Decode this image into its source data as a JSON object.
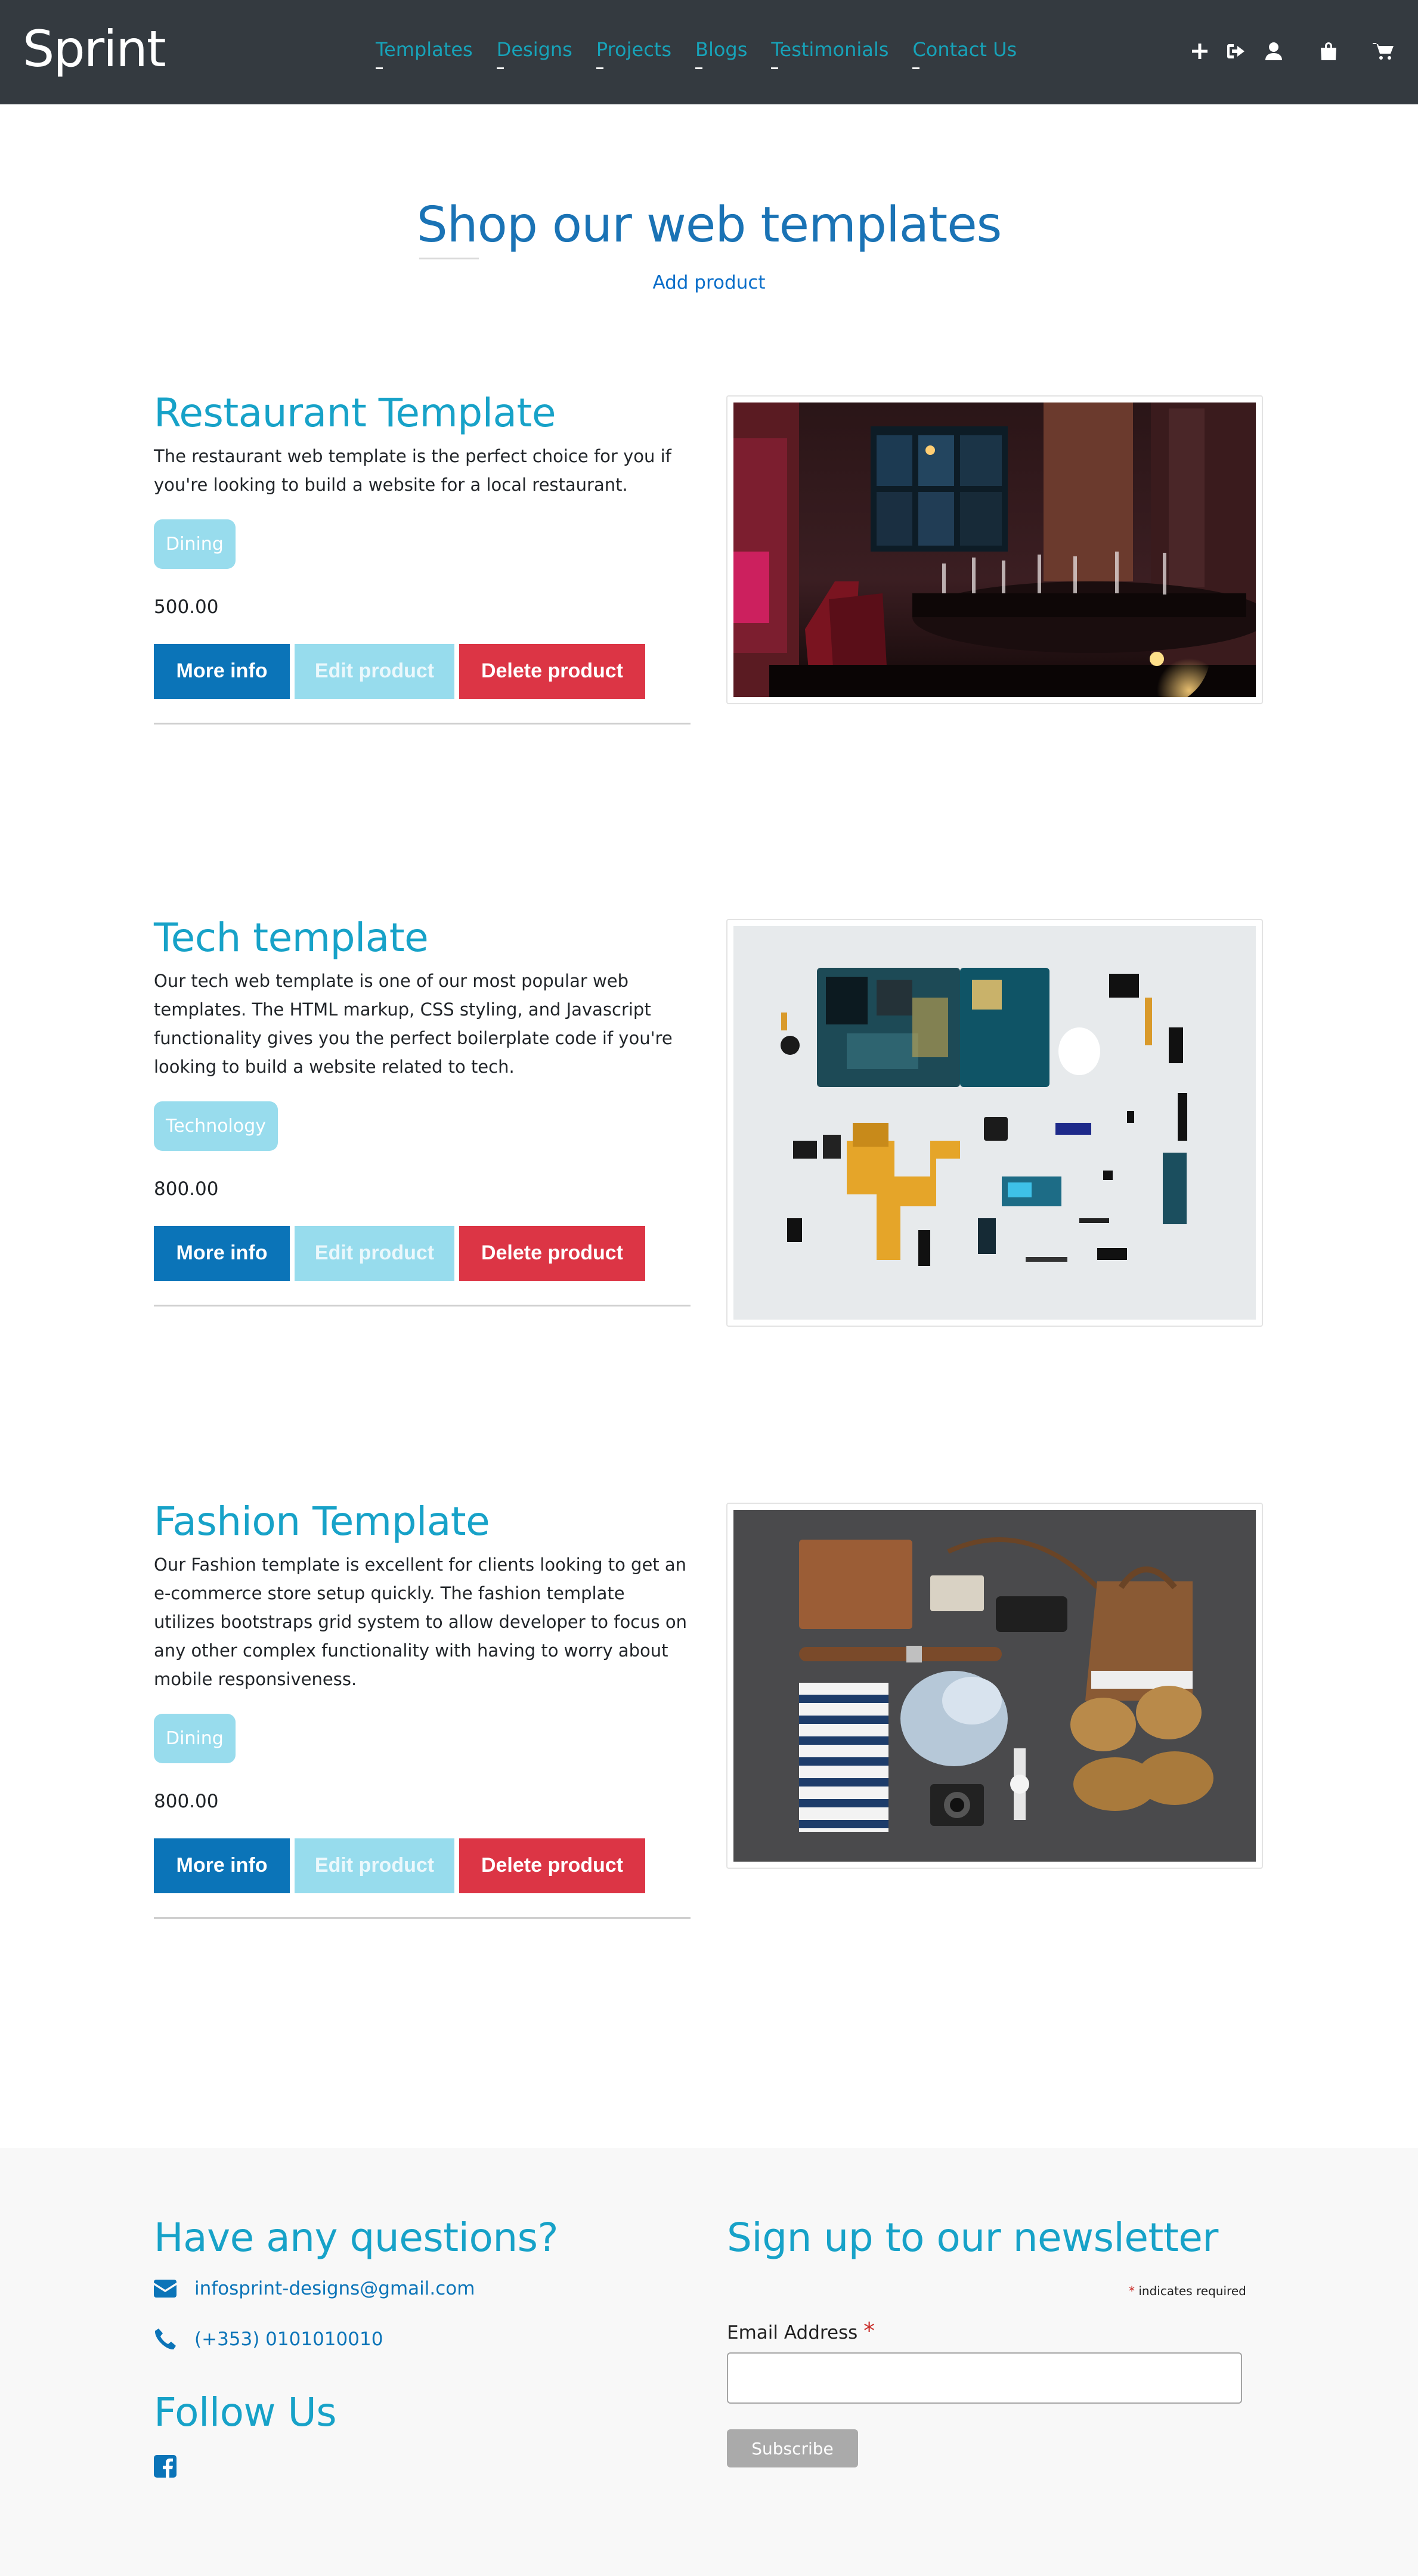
{
  "navbar": {
    "brand": "Sprint",
    "links": [
      "Templates",
      "Designs",
      "Projects",
      "Blogs",
      "Testimonials",
      "Contact Us"
    ],
    "icons": [
      "plus-icon",
      "sign-out-icon",
      "user-icon",
      "shopping-bag-icon",
      "shopping-cart-icon"
    ]
  },
  "header": {
    "title": "Shop our web templates",
    "add_product": "Add product"
  },
  "products": [
    {
      "name": "Restaurant Template",
      "description": "The restaurant web template is the perfect choice for you if you're looking to build a website for a local restaurant.",
      "tag": "Dining",
      "price": "500.00",
      "image": "restaurant interior photo"
    },
    {
      "name": "Tech template",
      "description": "Our tech web template is one of our most popular web templates. The HTML markup, CSS styling, and Javascript functionality gives you the perfect boilerplate code if you're looking to build a website related to tech.",
      "tag": "Technology",
      "price": "800.00",
      "image": "disassembled phone parts photo"
    },
    {
      "name": "Fashion Template",
      "description": "Our Fashion template is excellent for clients looking to get an e-commerce store setup quickly. The fashion template utilizes bootstraps grid system to allow developer to focus on any other complex functionality with having to worry about mobile responsiveness.",
      "tag": "Dining",
      "price": "800.00",
      "image": "flat lay fashion items photo"
    }
  ],
  "buttons": {
    "more_info": "More info",
    "edit": "Edit product",
    "delete": "Delete product"
  },
  "footer": {
    "questions_heading": "Have any questions?",
    "email": "infosprint-designs@gmail.com",
    "phone": "(+353) 0101010010",
    "follow_heading": "Follow Us",
    "newsletter_heading": "Sign up to our newsletter",
    "required_marker": "*",
    "required_note": " indicates required",
    "email_label": "Email Address ",
    "subscribe": "Subscribe"
  },
  "colors": {
    "navbar": "#343a40",
    "accent": "#17a2b8",
    "primary": "#0b74b8",
    "danger": "#dc3545",
    "tag": "#98dced"
  }
}
